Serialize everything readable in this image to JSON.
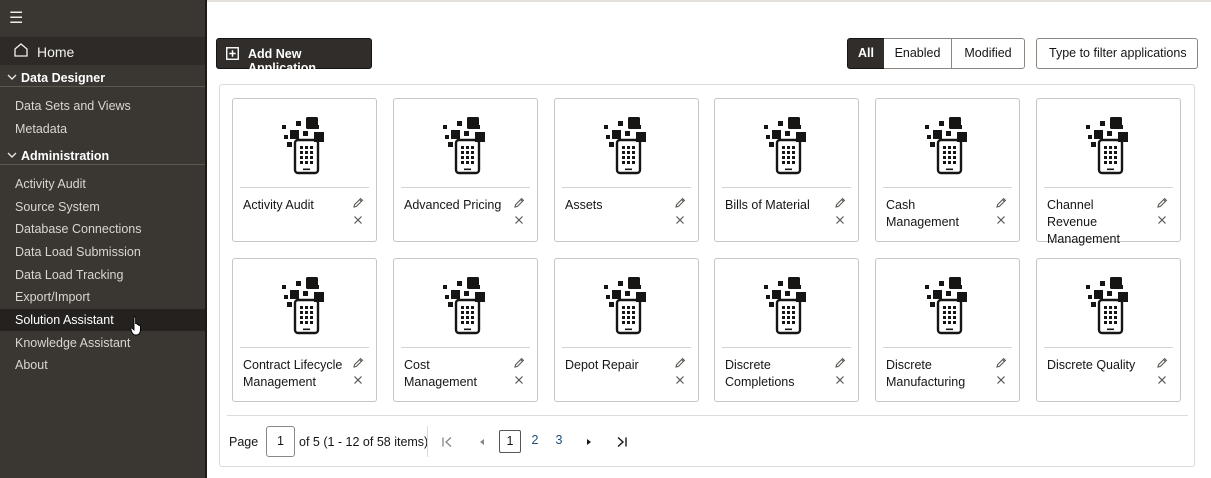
{
  "sidebar": {
    "home_label": "Home",
    "groups": [
      {
        "label": "Data Designer",
        "items": [
          "Data Sets and Views",
          "Metadata"
        ]
      },
      {
        "label": "Administration",
        "items": [
          "Activity Audit",
          "Source System",
          "Database Connections",
          "Data Load Submission",
          "Data Load Tracking",
          "Export/Import",
          "Solution Assistant",
          "Knowledge Assistant",
          "About"
        ]
      }
    ],
    "active_item": "Solution Assistant"
  },
  "toolbar": {
    "add_label": "Add New Application",
    "filter_options": [
      "All",
      "Enabled",
      "Modified"
    ],
    "selected_filter": "All",
    "filter_placeholder": "Type to filter applications"
  },
  "applications": [
    [
      "Activity Audit"
    ],
    [
      "Advanced Pricing"
    ],
    [
      "Assets"
    ],
    [
      "Bills of Material"
    ],
    [
      "Cash",
      "Management"
    ],
    [
      "Channel Revenue",
      "Management"
    ],
    [
      "Contract Lifecycle",
      "Management"
    ],
    [
      "Cost Management"
    ],
    [
      "Depot Repair"
    ],
    [
      "Discrete",
      "Completions"
    ],
    [
      "Discrete",
      "Manufacturing"
    ],
    [
      "Discrete Quality"
    ]
  ],
  "pagination": {
    "page_label": "Page",
    "current_page": "1",
    "info": "of 5 (1 - 12 of 58 items)",
    "pages": [
      "1",
      "2",
      "3"
    ]
  }
}
